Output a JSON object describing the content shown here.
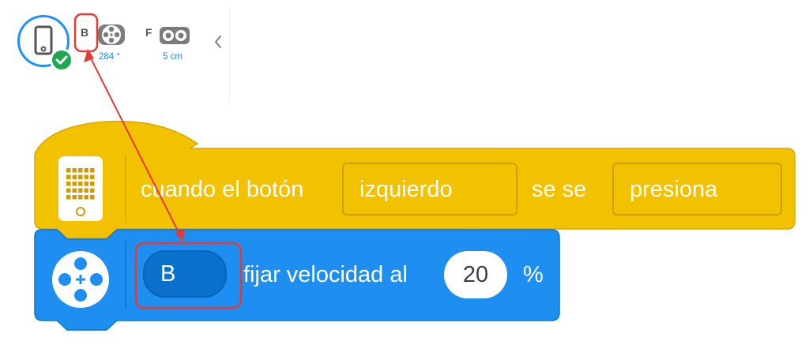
{
  "status_bar": {
    "ports": [
      {
        "letter": "B",
        "value": "284 °",
        "device": "motor-icon"
      },
      {
        "letter": "F",
        "value": "5 cm",
        "device": "distance-sensor-icon"
      }
    ],
    "hub_icon": "hub-device-icon",
    "connected_icon": "checkmark-icon",
    "collapse_icon": "chevron-left-icon"
  },
  "event_block": {
    "color": "#f2c200",
    "icon": "hub-matrix-icon",
    "text_prefix": "cuando el botón",
    "button_dropdown": "izquierdo",
    "text_middle": "se  se",
    "action_dropdown": "presiona"
  },
  "motor_block": {
    "color": "#1e8ff0",
    "icon": "motor-icon",
    "port_dropdown": "B",
    "text": "fijar velocidad al",
    "speed_value": "20",
    "unit": "%"
  },
  "annotation": {
    "color": "#e53935"
  }
}
